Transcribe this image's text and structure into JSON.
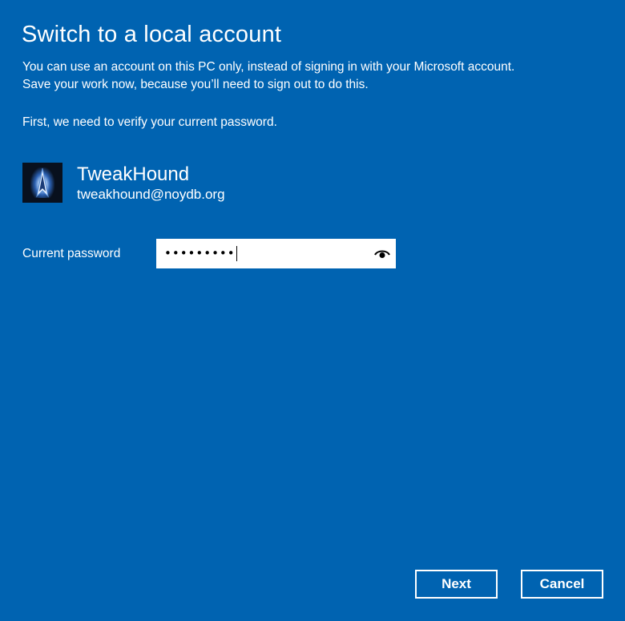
{
  "dialog": {
    "title": "Switch to a local account",
    "description_line1": "You can use an account on this PC only, instead of signing in with your Microsoft account.",
    "description_line2": "Save your work now, because you’ll need to sign out to do this.",
    "verify_text": "First, we need to verify your current password."
  },
  "account": {
    "name": "TweakHound",
    "email": "tweakhound@noydb.org",
    "avatar_icon": "star-trek-delta-icon"
  },
  "password": {
    "label": "Current password",
    "value": "•••••••••",
    "reveal_icon": "eye-icon"
  },
  "buttons": {
    "next_label": "Next",
    "cancel_label": "Cancel"
  },
  "colors": {
    "background": "#0063b1",
    "text": "#ffffff",
    "input_background": "#ffffff"
  }
}
